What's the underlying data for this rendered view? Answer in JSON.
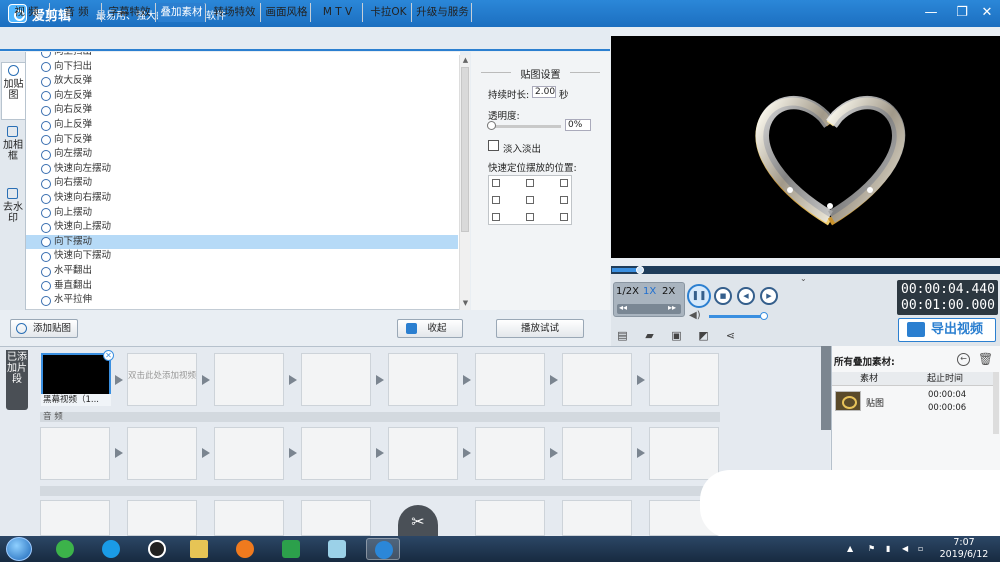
{
  "app": {
    "name": "爱剪辑",
    "slogan": "最易用、强大的视频剪辑软件"
  },
  "window_controls": {
    "minimize": "—",
    "maximize": "❐",
    "close": "✕"
  },
  "tabs": [
    "视 频",
    "音 频",
    "字幕特效",
    "叠加素材",
    "转场特效",
    "画面风格",
    "M T V",
    "卡拉OK",
    "升级与服务"
  ],
  "active_tab": "叠加素材",
  "side_tabs": [
    "加贴图",
    "加相框",
    "去水印"
  ],
  "effects": [
    "向上扫出",
    "向下扫出",
    "放大反弹",
    "向左反弹",
    "向右反弹",
    "向上反弹",
    "向下反弹",
    "向左摆动",
    "快速向左摆动",
    "向右摆动",
    "快速向右摆动",
    "向上摆动",
    "快速向上摆动",
    "向下摆动",
    "快速向下摆动",
    "水平翻出",
    "垂直翻出",
    "水平拉伸"
  ],
  "selected_effect": "向下摆动",
  "settings": {
    "title": "贴图设置",
    "duration_label": "持续时长:",
    "duration_value": "2.00",
    "duration_unit": "秒",
    "opacity_label": "透明度:",
    "opacity_value": "0%",
    "fade_label": "淡入淡出",
    "position_label": "快速定位摆放的位置:",
    "play_button": "播放试试"
  },
  "buttons": {
    "add_sticker": "添加贴图",
    "collapse": "收起"
  },
  "player": {
    "speeds": [
      "1/2X",
      "1X",
      "2X"
    ],
    "active_speed": "1X",
    "current_time": "00:00:04.440",
    "total_time": "00:01:00.000",
    "progress": 0.07,
    "volume": 0.8,
    "export_label": "导出视频"
  },
  "timeline": {
    "added_clips_label": "已添加片段",
    "clip_name": "黑幕视频（1...",
    "empty_slot": "双击此处添加视频",
    "audio_label": "音 频"
  },
  "overlay_panel": {
    "title": "所有叠加素材:",
    "col_material": "素材",
    "col_time": "起止时间",
    "item_name": "贴图",
    "item_start": "00:00:04",
    "item_end": "00:00:06"
  },
  "taskbar": {
    "time": "7:07",
    "date": "2019/6/12"
  },
  "colors": {
    "accent": "#2b7fd0",
    "selected_row": "#b6daf7",
    "titlebar": "#1c6fc0"
  }
}
